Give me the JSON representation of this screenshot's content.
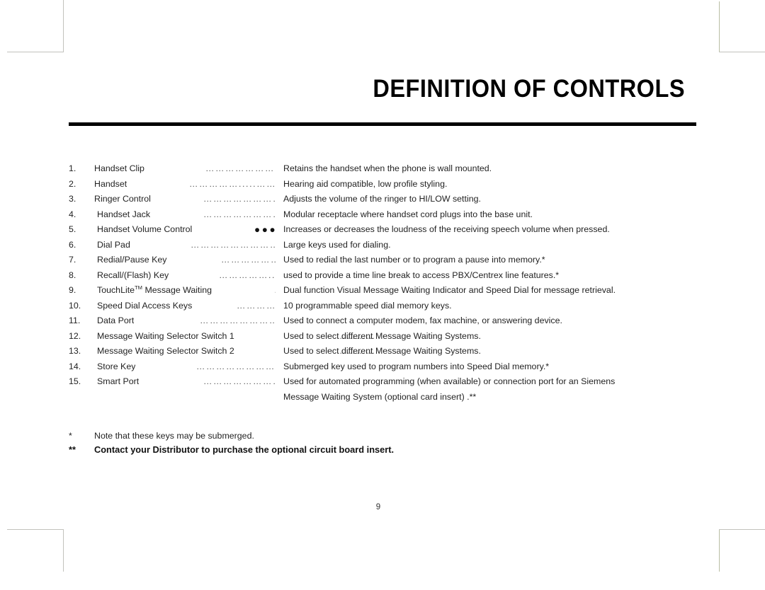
{
  "document": {
    "title": "DEFINITION OF CONTROLS",
    "page_number": "9"
  },
  "controls": [
    {
      "num": "1.",
      "term": "Handset Clip",
      "leader": "……………………………………",
      "leader_style": "normal",
      "desc": "Retains the handset when the phone is wall mounted.",
      "indent": false
    },
    {
      "num": "2.",
      "term": "Handset",
      "leader": "…………….....…………….....……..",
      "leader_style": "normal",
      "desc": "Hearing aid compatible, low profile styling.",
      "indent": false
    },
    {
      "num": "3.",
      "term": "Ringer Control",
      "leader": "…………………………………",
      "leader_style": "normal",
      "desc": "Adjusts the volume of the ringer to HI/LOW setting.",
      "indent": false
    },
    {
      "num": "4.",
      "term": "Handset Jack",
      "leader": "………………………………….",
      "leader_style": "normal",
      "desc": "Modular receptacle where handset cord plugs into the base unit.",
      "indent": true
    },
    {
      "num": "5.",
      "term": "Handset Volume Control",
      "leader": "●●●●●●●●●●●●●●●●●●",
      "leader_style": "bold",
      "desc": "Increases or decreases  the loudness of the receiving speech volume when pressed.",
      "indent": true
    },
    {
      "num": "6.",
      "term": "Dial Pad",
      "leader": "……………………………………….",
      "leader_style": "normal",
      "desc": "Large keys used for dialing.",
      "indent": true
    },
    {
      "num": "7.",
      "term": "Redial/Pause Key",
      "leader": "…………………………….",
      "leader_style": "normal",
      "desc": "Used to redial the last number or to program a pause into memory.*",
      "indent": true
    },
    {
      "num": "8.",
      "term": "Recall/(Flash) Key",
      "leader": "……………...…………..",
      "leader_style": "normal",
      "desc": " used to provide a time  line break to access PBX/Centrex line features.*",
      "indent": true
    },
    {
      "num": "9.",
      "term": "TouchLite™ Message Waiting",
      "leader": "………………",
      "leader_style": "normal",
      "desc": "Dual function Visual Message Waiting Indicator and Speed Dial for message retrieval.",
      "indent": true
    },
    {
      "num": "10.",
      "term": "Speed Dial Access Keys",
      "leader": "……………………",
      "leader_style": "normal",
      "desc": "10 programmable speed dial memory keys.",
      "indent": true
    },
    {
      "num": "11.",
      "term": "Data Port",
      "leader": "…………………………………….",
      "leader_style": "normal",
      "desc": "Used to connect a computer modem, fax machine, or answering device.",
      "indent": true
    },
    {
      "num": "12.",
      "term": "Message Waiting Selector Switch 1",
      "leader": "…………",
      "leader_style": "normal",
      "desc": "Used to select different Message Waiting Systems.",
      "indent": true
    },
    {
      "num": "13.",
      "term": "Message Waiting Selector Switch 2",
      "leader": "…………",
      "leader_style": "normal",
      "desc": "Used to select different Message Waiting Systems.",
      "indent": true
    },
    {
      "num": "14.",
      "term": "Store Key",
      "leader": "……………………………………",
      "leader_style": "normal",
      "desc": "Submerged key used to program numbers into Speed Dial memory.*",
      "indent": true
    },
    {
      "num": "15.",
      "term": "Smart Port",
      "leader": "……………………………………",
      "leader_style": "normal",
      "desc": "Used for automated programming (when available) or connection port for an Siemens",
      "indent": true
    }
  ],
  "continuation_line": "Message Waiting System (optional card insert) .**",
  "footnotes": [
    {
      "mark": "*",
      "text": "Note that these keys may be submerged.",
      "strong": false
    },
    {
      "mark": "**",
      "text": "Contact your Distributor to purchase the optional circuit board insert.",
      "strong": true
    }
  ]
}
